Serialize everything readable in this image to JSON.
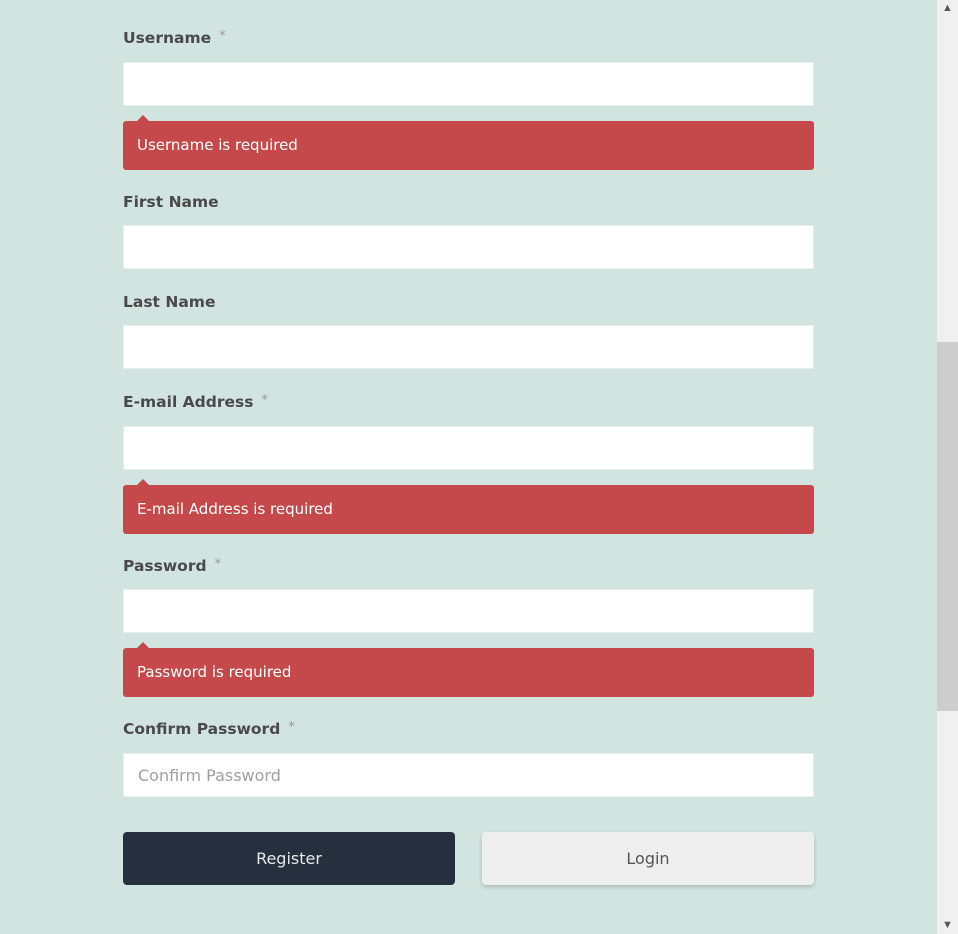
{
  "fields": [
    {
      "label": "Username",
      "required_mark": "*",
      "value": "",
      "placeholder": "",
      "error": "Username is required"
    },
    {
      "label": "First Name",
      "required_mark": "",
      "value": "",
      "placeholder": "",
      "error": ""
    },
    {
      "label": "Last Name",
      "required_mark": "",
      "value": "",
      "placeholder": "",
      "error": ""
    },
    {
      "label": "E-mail Address",
      "required_mark": "*",
      "value": "",
      "placeholder": "",
      "error": "E-mail Address is required"
    },
    {
      "label": "Password",
      "required_mark": "*",
      "value": "",
      "placeholder": "",
      "error": "Password is required"
    },
    {
      "label": "Confirm Password",
      "required_mark": "*",
      "value": "",
      "placeholder": "Confirm Password",
      "error": ""
    }
  ],
  "buttons": {
    "register": "Register",
    "login": "Login"
  },
  "colors": {
    "background": "#d2e4df",
    "error": "#c5494b",
    "primary_button": "#262f3d",
    "secondary_button": "#eeeeee"
  },
  "scrollbar": {
    "up_icon": "▲",
    "down_icon": "▼"
  }
}
